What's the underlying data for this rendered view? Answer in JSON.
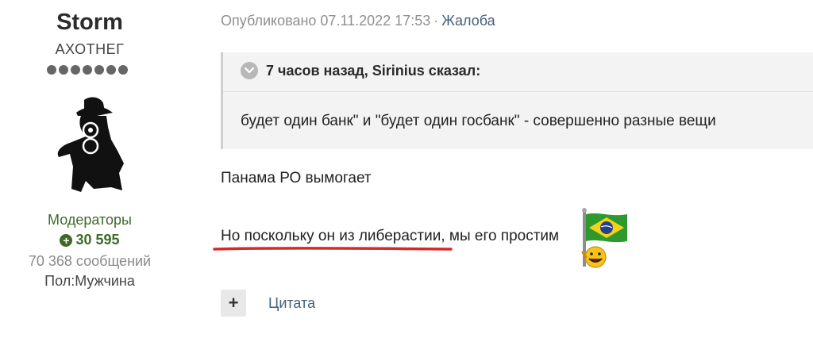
{
  "author": {
    "name": "Storm",
    "title": "АХОТНЕГ",
    "pips": 7,
    "group": "Модераторы",
    "reputation": "30 595",
    "posts": "70 368 сообщений",
    "gender": "Пол:Мужчина"
  },
  "post": {
    "published": "Опубликовано 07.11.2022 17:53",
    "separator": "·",
    "report": "Жалоба",
    "quote": {
      "header": "7 часов назад, Sirinius сказал:",
      "text": "будет один банк\" и \"будет один госбанк\" - совершенно разные вещи"
    },
    "paragraphs": [
      "Панама РО вымогает",
      "Но поскольку он из либерастии, мы его простим"
    ],
    "quote_button": {
      "icon": "+",
      "label": "Цитата"
    }
  },
  "colors": {
    "group": "#3f6a2d",
    "link": "#43607e",
    "underline": "#d42a2a"
  }
}
